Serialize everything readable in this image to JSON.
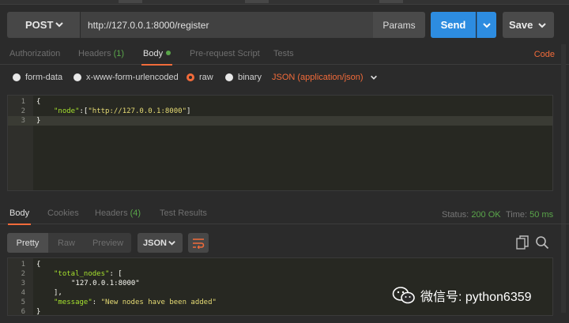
{
  "request": {
    "method": "POST",
    "url": "http://127.0.0.1:8000/register",
    "params_label": "Params",
    "send_label": "Send",
    "save_label": "Save"
  },
  "request_tabs": [
    {
      "label": "Authorization"
    },
    {
      "label": "Headers",
      "count": "(1)"
    },
    {
      "label": "Body"
    },
    {
      "label": "Pre-request Script"
    },
    {
      "label": "Tests"
    }
  ],
  "code_link": "Code",
  "body_types": [
    {
      "label": "form-data"
    },
    {
      "label": "x-www-form-urlencoded"
    },
    {
      "label": "raw"
    },
    {
      "label": "binary"
    }
  ],
  "content_type": "JSON (application/json)",
  "request_body": {
    "line_numbers": [
      "1",
      "2",
      "3"
    ],
    "open": "{",
    "key": "\"node\"",
    "sep": ":[",
    "value": "\"http://127.0.0.1:8000\"",
    "end": "]",
    "close": "}"
  },
  "response_tabs": [
    {
      "label": "Body"
    },
    {
      "label": "Cookies"
    },
    {
      "label": "Headers",
      "count": "(4)"
    },
    {
      "label": "Test Results"
    }
  ],
  "status": {
    "label": "Status:",
    "value": "200 OK"
  },
  "time": {
    "label": "Time:",
    "value": "50 ms"
  },
  "view_modes": [
    "Pretty",
    "Raw",
    "Preview"
  ],
  "format": "JSON",
  "response_body": {
    "line_numbers": [
      "1",
      "2",
      "3",
      "4",
      "5",
      "6"
    ],
    "l1": "{",
    "l2_key": "\"total_nodes\"",
    "l2_rest": ": [",
    "l3": "\"127.0.0.1:8000\"",
    "l4": "],",
    "l5_key": "\"message\"",
    "l5_sep": ": ",
    "l5_val": "\"New nodes have been added\"",
    "l6": "}"
  },
  "watermark": "微信号: python6359",
  "colors": {
    "accent": "#f26b3a",
    "send": "#2d8ce0",
    "ok": "#5aa64a"
  }
}
